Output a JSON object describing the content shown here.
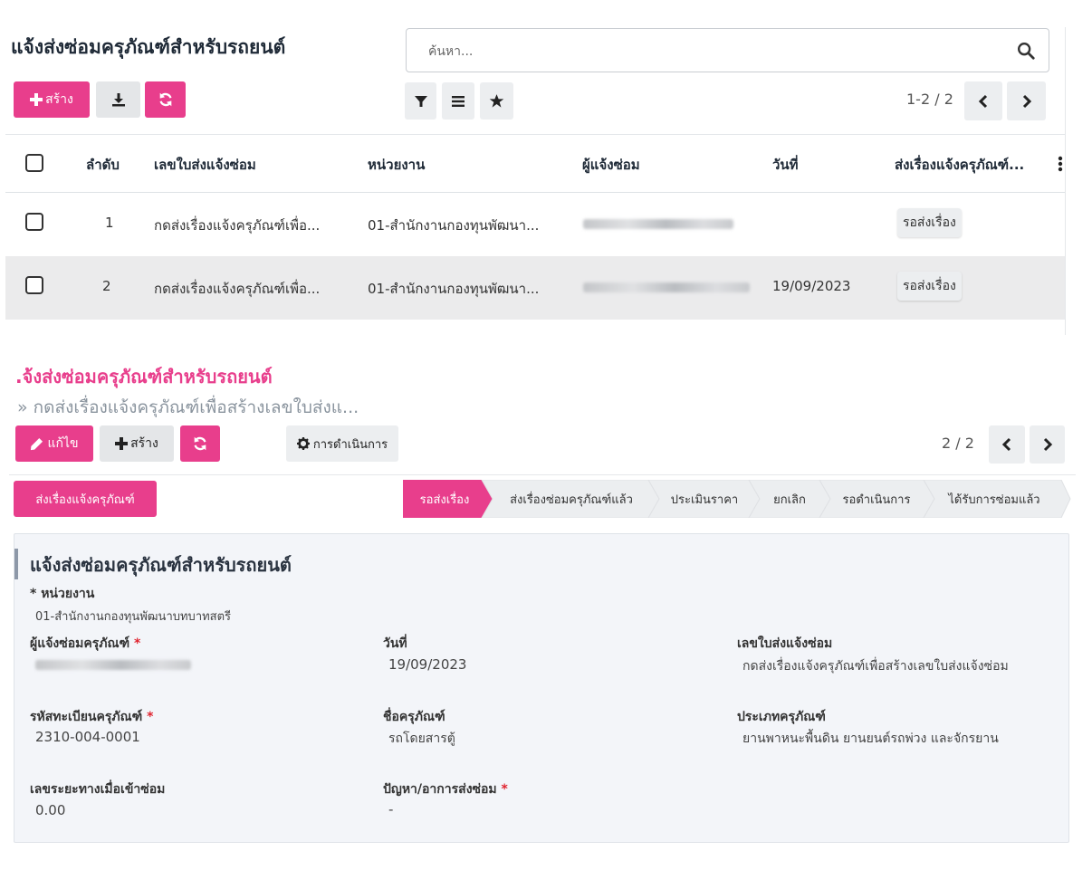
{
  "list_view": {
    "title": "แจ้งส่งซ่อมครุภัณฑ์สำหรับรถยนต์",
    "search_placeholder": "ค้นหา...",
    "create_label": "สร้าง",
    "pager": "1-2 / 2",
    "columns": [
      "ลำดับ",
      "เลขใบส่งแจ้งซ่อม",
      "หน่วยงาน",
      "ผู้แจ้งซ่อม",
      "วันที่",
      "ส่งเรื่องแจ้งครุภัณฑ์..."
    ],
    "rows": [
      {
        "seq": "1",
        "doc": "กดส่งเรื่องแจ้งครุภัณฑ์เพื่อ...",
        "unit": "01-สำนักงานกองทุนพัฒนา...",
        "date": "",
        "status": "รอส่งเรื่อง"
      },
      {
        "seq": "2",
        "doc": "กดส่งเรื่องแจ้งครุภัณฑ์เพื่อ...",
        "unit": "01-สำนักงานกองทุนพัฒนา...",
        "date": "19/09/2023",
        "status": "รอส่งเรื่อง"
      }
    ]
  },
  "form_view": {
    "breadcrumb_root": ".จ้งส่งซ่อมครุภัณฑ์สำหรับรถยนต์",
    "breadcrumb_current": "» กดส่งเรื่องแจ้งครุภัณฑ์เพื่อสร้างเลขใบส่งแ...",
    "edit_label": "แก้ไข",
    "create_label": "สร้าง",
    "action_label": "การดำเนินการ",
    "pager": "2 / 2",
    "send_button": "ส่งเรื่องแจ้งครุภัณฑ์",
    "stages": [
      "รอส่งเรื่อง",
      "ส่งเรื่องซ่อมครุภัณฑ์แล้ว",
      "ประเมินราคา",
      "ยกเลิก",
      "รอดำเนินการ",
      "ได้รับการซ่อมแล้ว"
    ],
    "active_stage": "รอส่งเรื่อง",
    "sheet_title": "แจ้งส่งซ่อมครุภัณฑ์สำหรับรถยนต์",
    "fields": {
      "unit_label": "หน่วยงาน",
      "unit_value": "01-สำนักงานกองทุนพัฒนาบทบาทสตรี",
      "reporter_label": "ผู้แจ้งซ่อมครุภัณฑ์",
      "date_label": "วันที่",
      "date_value": "19/09/2023",
      "doc_label": "เลขใบส่งแจ้งซ่อม",
      "doc_value": "กดส่งเรื่องแจ้งครุภัณฑ์เพื่อสร้างเลขใบส่งแจ้งซ่อม",
      "asset_code_label": "รหัสทะเบียนครุภัณฑ์",
      "asset_code_value": "2310-004-0001",
      "asset_name_label": "ชื่อครุภัณฑ์",
      "asset_name_value": "รถโดยสารตู้",
      "asset_type_label": "ประเภทครุภัณฑ์",
      "asset_type_value": "ยานพาหนะพื้นดิน ยานยนต์รถพ่วง และจักรยาน",
      "mileage_label": "เลขระยะทางเมื่อเข้าซ่อม",
      "mileage_value": "0.00",
      "problem_label": "ปัญหา/อาการส่งซ่อม",
      "problem_value": "-"
    }
  },
  "colors": {
    "accent": "#e83e8c",
    "sheet_bg": "#f3f5f9",
    "stage_inactive": "#eceef0"
  },
  "icons": [
    "plus-icon",
    "download-icon",
    "refresh-icon",
    "search-icon",
    "filter-icon",
    "list-icon",
    "star-icon",
    "chevron-left-icon",
    "chevron-right-icon",
    "pencil-icon",
    "gear-icon",
    "kebab-icon"
  ]
}
